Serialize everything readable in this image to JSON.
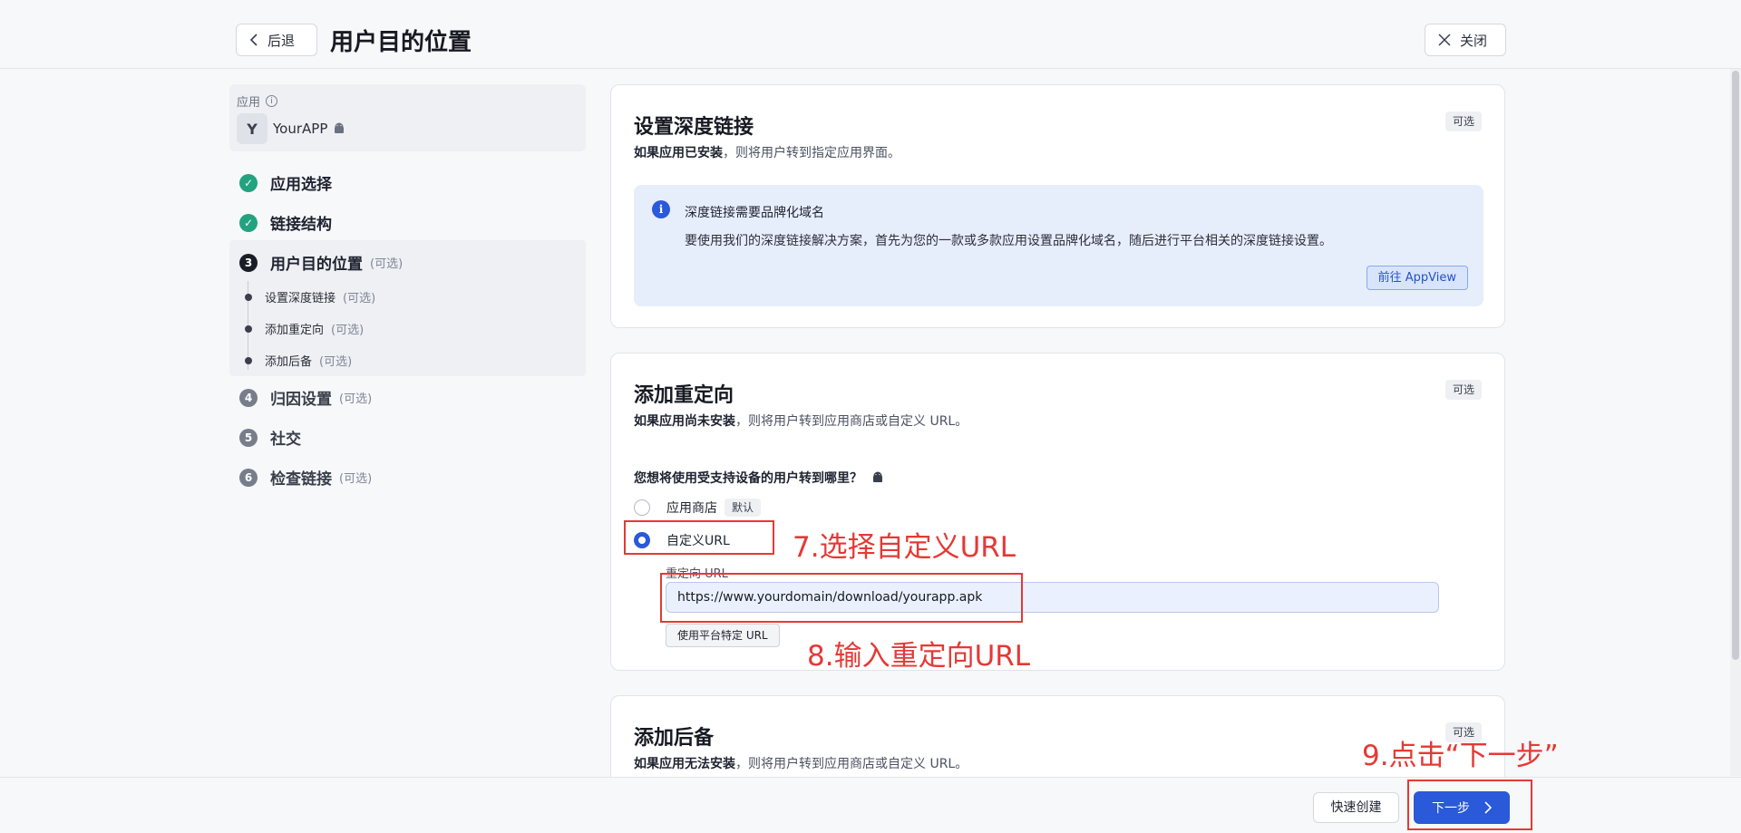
{
  "header": {
    "back_label": "后退",
    "title": "用户目的位置",
    "close_label": "关闭"
  },
  "sidebar": {
    "app_label": "应用",
    "app_initial": "Y",
    "app_name": "YourAPP",
    "steps": [
      {
        "num": "✓",
        "label": "应用选择",
        "optional": ""
      },
      {
        "num": "✓",
        "label": "链接结构",
        "optional": ""
      },
      {
        "num": "3",
        "label": "用户目的位置",
        "optional": "(可选)"
      },
      {
        "num": "4",
        "label": "归因设置",
        "optional": "(可选)"
      },
      {
        "num": "5",
        "label": "社交",
        "optional": ""
      },
      {
        "num": "6",
        "label": "检查链接",
        "optional": "(可选)"
      }
    ],
    "substeps": [
      {
        "label": "设置深度链接",
        "optional": "(可选)"
      },
      {
        "label": "添加重定向",
        "optional": "(可选)"
      },
      {
        "label": "添加后备",
        "optional": "(可选)"
      }
    ]
  },
  "deeplink_card": {
    "title": "设置深度链接",
    "subtitle_bold": "如果应用已安装",
    "subtitle_rest": "，则将用户转到指定应用界面。",
    "badge": "可选",
    "info_title": "深度链接需要品牌化域名",
    "info_text": "要使用我们的深度链接解决方案，首先为您的一款或多款应用设置品牌化域名，随后进行平台相关的深度链接设置。",
    "info_button": "前往 AppView"
  },
  "redirect_card": {
    "title": "添加重定向",
    "subtitle_bold": "如果应用尚未安装",
    "subtitle_rest": "，则将用户转到应用商店或自定义 URL。",
    "badge": "可选",
    "question": "您想将使用受支持设备的用户转到哪里？",
    "option_store": "应用商店",
    "default_badge": "默认",
    "option_custom": "自定义URL",
    "field_label": "重定向 URL",
    "url_value": "https://www.yourdomain/download/yourapp.apk",
    "platform_button": "使用平台特定 URL"
  },
  "fallback_card": {
    "title": "添加后备",
    "subtitle_bold": "如果应用无法安装",
    "subtitle_rest": "，则将用户转到应用商店或自定义 URL。",
    "badge": "可选"
  },
  "annotations": {
    "step7": "7.选择自定义URL",
    "step8": "8.输入重定向URL",
    "step9": "9.点击“下一步”"
  },
  "footer": {
    "quick_create": "快速创建",
    "next": "下一步"
  },
  "colors": {
    "primary": "#2a59d9",
    "success": "#21a37f",
    "annotation": "#e53935"
  }
}
